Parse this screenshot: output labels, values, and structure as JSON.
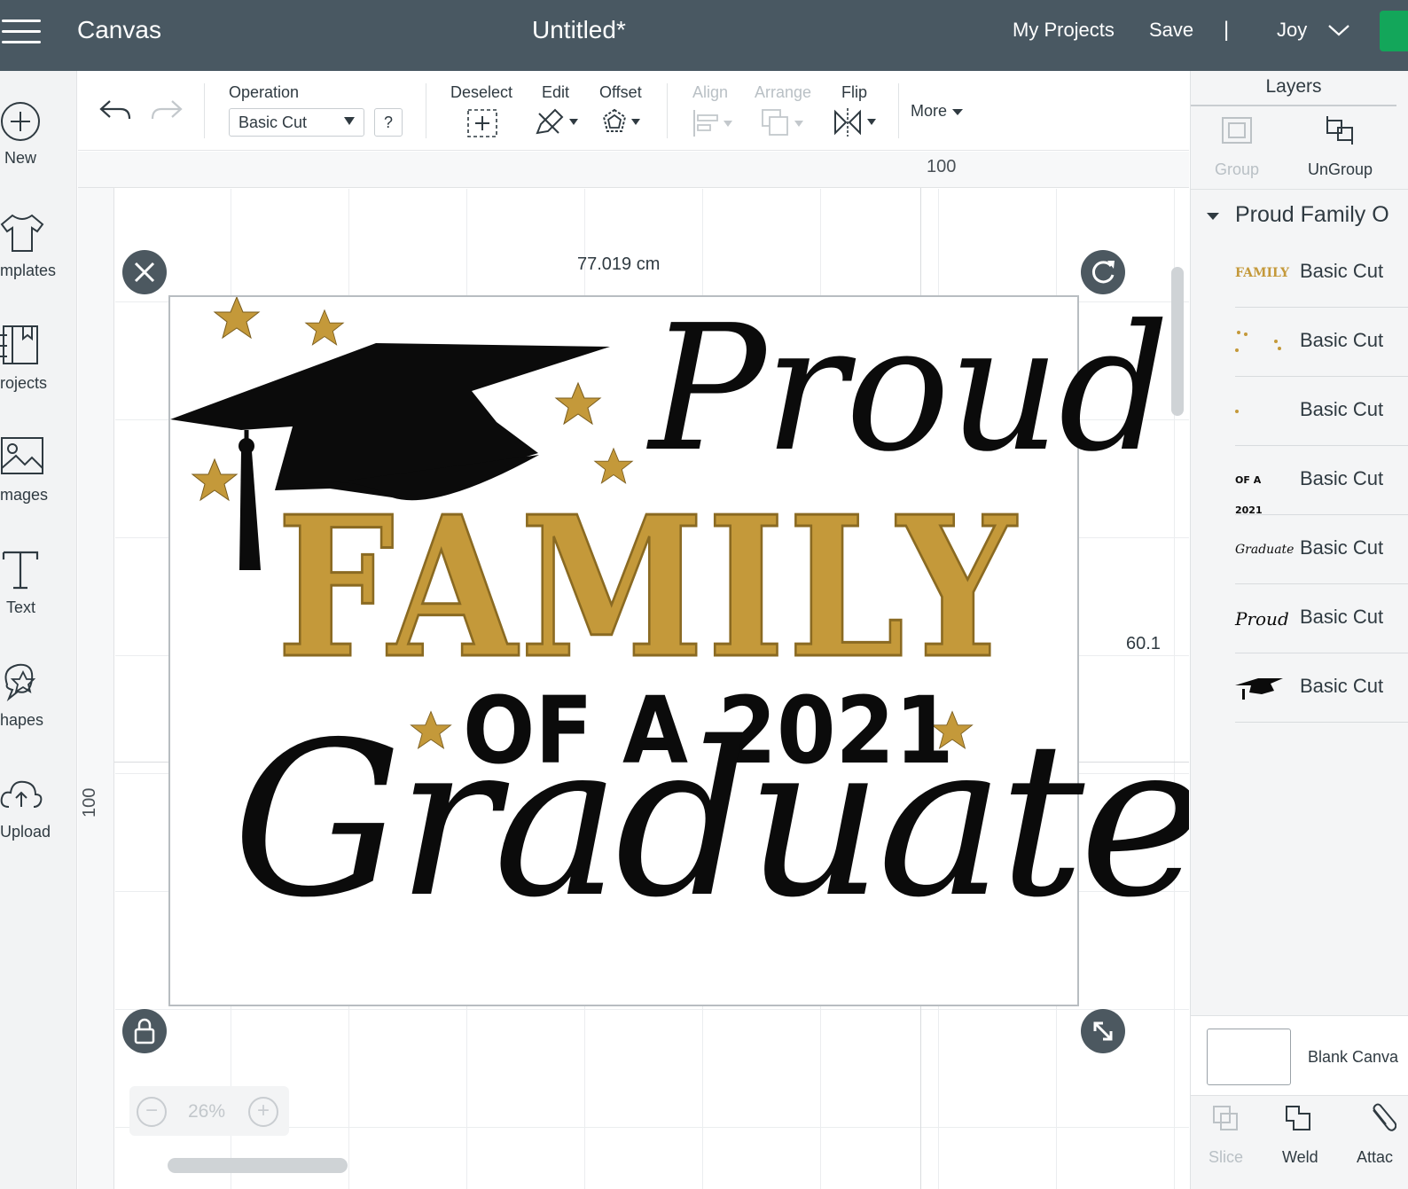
{
  "header": {
    "app_title": "Canvas",
    "doc_title": "Untitled*",
    "my_projects": "My Projects",
    "save": "Save",
    "separator": "|",
    "user": "Joy"
  },
  "sidebar": {
    "items": [
      {
        "label": "New",
        "icon": "plus-circle-icon"
      },
      {
        "label": "mplates",
        "icon": "tshirt-icon"
      },
      {
        "label": "rojects",
        "icon": "book-icon"
      },
      {
        "label": "mages",
        "icon": "image-icon"
      },
      {
        "label": "Text",
        "icon": "text-icon"
      },
      {
        "label": "hapes",
        "icon": "shapes-icon"
      },
      {
        "label": "Upload",
        "icon": "upload-cloud-icon"
      }
    ]
  },
  "toolbar": {
    "operation_label": "Operation",
    "operation_value": "Basic Cut",
    "help": "?",
    "deselect": "Deselect",
    "edit": "Edit",
    "offset": "Offset",
    "align": "Align",
    "arrange": "Arrange",
    "flip": "Flip",
    "more": "More"
  },
  "canvas": {
    "ruler_top_label": "100",
    "ruler_left_label": "100",
    "width_dim": "77.019 cm",
    "height_dim": "60.1",
    "zoom_minus": "−",
    "zoom_plus": "+",
    "zoom_value": "26%"
  },
  "artwork": {
    "line1": "Proud",
    "line2": "FAMILY",
    "line3": "OF A 2021",
    "line4": "Graduate",
    "colors": {
      "gold": "#c4993a",
      "black": "#0b0b0b"
    }
  },
  "layers_panel": {
    "title": "Layers",
    "group_btn": "Group",
    "ungroup_btn": "UnGroup",
    "group_name": "Proud Family O",
    "layers": [
      {
        "thumb_text": "FAMILY",
        "name": "Basic Cut"
      },
      {
        "thumb_text": "",
        "name": "Basic Cut"
      },
      {
        "thumb_text": "",
        "name": "Basic Cut"
      },
      {
        "thumb_text": "OF A 2021",
        "name": "Basic Cut"
      },
      {
        "thumb_text": "Graduate",
        "name": "Basic Cut"
      },
      {
        "thumb_text": "Proud",
        "name": "Basic Cut"
      },
      {
        "thumb_text": "",
        "name": "Basic Cut"
      }
    ],
    "blank_canvas": "Blank Canva",
    "slice": "Slice",
    "weld": "Weld",
    "attach": "Attac"
  }
}
